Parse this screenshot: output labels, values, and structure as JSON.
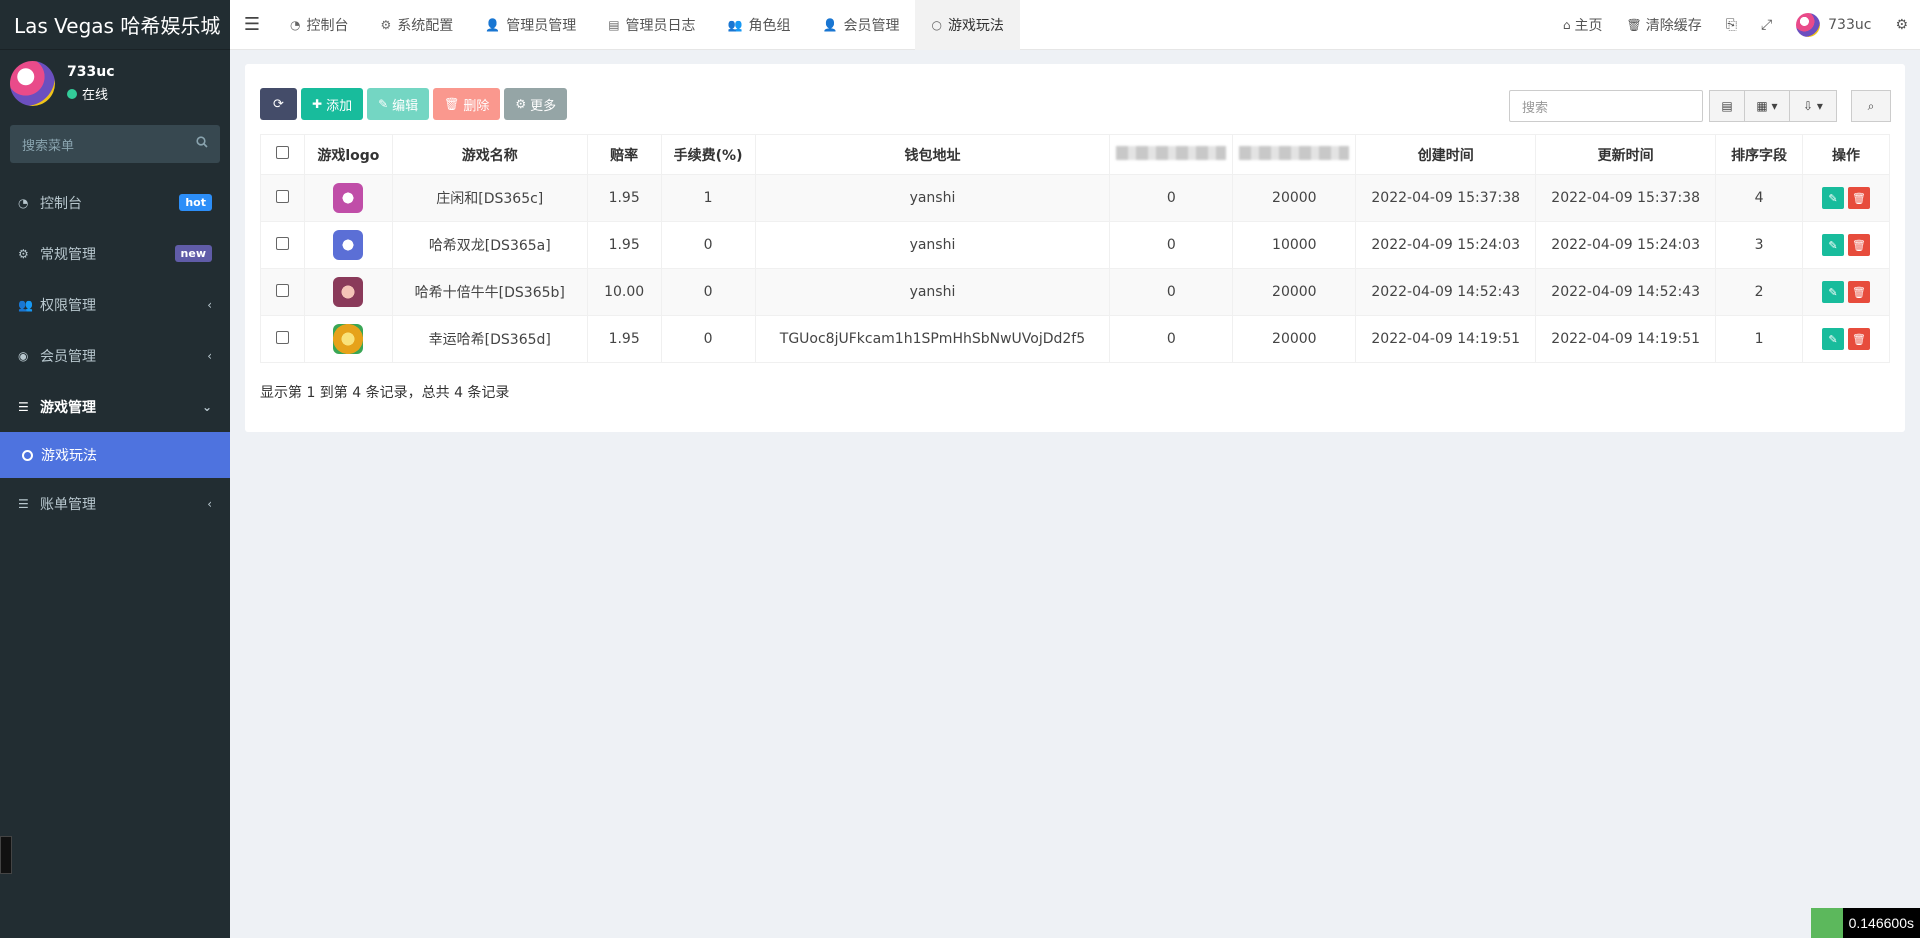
{
  "app": {
    "title": "Las Vegas 哈希娱乐城"
  },
  "user": {
    "name": "733uc",
    "status": "在线"
  },
  "sidebar": {
    "search_placeholder": "搜索菜单",
    "items": [
      {
        "label": "控制台",
        "icon": "dashboard-icon",
        "badge": "hot"
      },
      {
        "label": "常规管理",
        "icon": "cogs-icon",
        "badge": "new"
      },
      {
        "label": "权限管理",
        "icon": "users-icon"
      },
      {
        "label": "会员管理",
        "icon": "user-circle-icon"
      },
      {
        "label": "游戏管理",
        "icon": "list-icon"
      },
      {
        "label": "账单管理",
        "icon": "list-icon"
      }
    ],
    "subitem": {
      "label": "游戏玩法"
    }
  },
  "header": {
    "tabs": [
      {
        "label": "控制台",
        "icon": "dashboard-icon"
      },
      {
        "label": "系统配置",
        "icon": "gear-icon"
      },
      {
        "label": "管理员管理",
        "icon": "user-icon"
      },
      {
        "label": "管理员日志",
        "icon": "list-alt-icon"
      },
      {
        "label": "角色组",
        "icon": "group-icon"
      },
      {
        "label": "会员管理",
        "icon": "user-icon"
      },
      {
        "label": "游戏玩法",
        "icon": "circle-icon"
      }
    ],
    "right": {
      "home": "主页",
      "clear_cache": "清除缓存",
      "username": "733uc"
    }
  },
  "toolbar": {
    "add": "添加",
    "edit": "编辑",
    "delete": "删除",
    "more": "更多",
    "search_placeholder": "搜索"
  },
  "table": {
    "headers": [
      "游戏logo",
      "游戏名称",
      "赔率",
      "手续费(%)",
      "钱包地址",
      "",
      "",
      "创建时间",
      "更新时间",
      "排序字段",
      "操作"
    ],
    "rows": [
      {
        "name": "庄闲和[DS365c]",
        "odds": "1.95",
        "fee": "1",
        "wallet": "yanshi",
        "c1": "0",
        "c2": "20000",
        "created": "2022-04-09 15:37:38",
        "updated": "2022-04-09 15:37:38",
        "sort": "4",
        "logo_color": "#c04ea8"
      },
      {
        "name": "哈希双龙[DS365a]",
        "odds": "1.95",
        "fee": "0",
        "wallet": "yanshi",
        "c1": "0",
        "c2": "10000",
        "created": "2022-04-09 15:24:03",
        "updated": "2022-04-09 15:24:03",
        "sort": "3",
        "logo_color": "#5b6fd6"
      },
      {
        "name": "哈希十倍牛牛[DS365b]",
        "odds": "10.00",
        "fee": "0",
        "wallet": "yanshi",
        "c1": "0",
        "c2": "20000",
        "created": "2022-04-09 14:52:43",
        "updated": "2022-04-09 14:52:43",
        "sort": "2",
        "logo_color": "#8a3a5a"
      },
      {
        "name": "幸运哈希[DS365d]",
        "odds": "1.95",
        "fee": "0",
        "wallet": "TGUoc8jUFkcam1h1SPmHhSbNwUVojDd2f5",
        "c1": "0",
        "c2": "20000",
        "created": "2022-04-09 14:19:51",
        "updated": "2022-04-09 14:19:51",
        "sort": "1",
        "logo_color": "#e6a21a"
      }
    ]
  },
  "pagination": {
    "info": "显示第 1 到第 4 条记录，总共 4 条记录"
  },
  "debug": {
    "time": "0.146600s"
  }
}
